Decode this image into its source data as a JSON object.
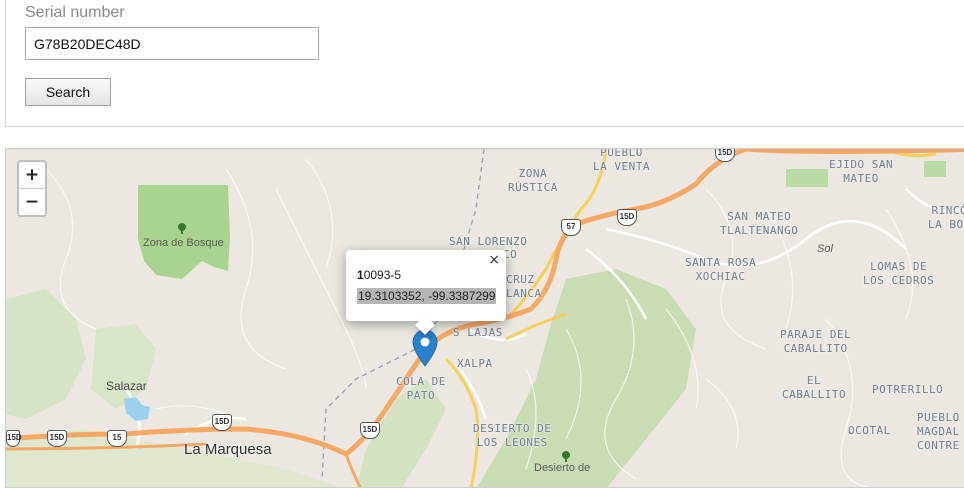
{
  "search": {
    "label": "Serial number",
    "serial_value": "G78B20DEC48D",
    "button_label": "Search"
  },
  "map": {
    "zoom_in": "+",
    "zoom_out": "−",
    "popup": {
      "title_first": "1",
      "title_rest": "0093-5",
      "coordinates": "19.3103352, -99.3387299",
      "close": "×"
    },
    "places": {
      "zona_bosque": "Zona de Bosque",
      "salazar": "Salazar",
      "la_marquesa": "La Marquesa",
      "pueblo_venta_1": "PUEBLO",
      "pueblo_venta_2": "LA VENTA",
      "zona_rustica_1": "ZONA",
      "zona_rustica_2": "RÚSTICA",
      "ejido_1": "EJIDO SAN",
      "ejido_2": "MATEO",
      "rincon_1": "RINCÓN",
      "rincon_2": "LA BOLS",
      "san_lorenzo": "SAN LORENZO",
      "san_lorenzo_b": "CO",
      "san_mateo_1": "SAN MATEO",
      "san_mateo_2": "TLALTENANGO",
      "sol": "Sol",
      "santa_rosa_1": "SANTA ROSA",
      "santa_rosa_2": "XOCHIAC",
      "lomas_1": "LOMAS DE",
      "lomas_2": "LOS CEDROS",
      "cruz_1": "CRUZ",
      "cruz_2": "LANCA",
      "las_lajas": "S LAJAS",
      "xalpa": "XALPA",
      "cola_1": "COLA DE",
      "cola_2": "PATO",
      "paraje_1": "PARAJE DEL",
      "paraje_2": "CABALLITO",
      "el_cab_1": "EL",
      "el_cab_2": "CABALLITO",
      "potrerillo": "POTRERILLO",
      "desierto_1": "DESIERTO DE",
      "desierto_2": "LOS LEONES",
      "desierto_park": "Desierto de",
      "ocotal": "OCOTAL",
      "pueblo_mag_1": "PUEBLO",
      "pueblo_mag_2": "MAGDAL",
      "pueblo_mag_3": "CONTRE"
    },
    "shields": {
      "s1": "15D",
      "s2": "57",
      "s3": "15D",
      "s4": "15D",
      "s5": "15",
      "s6": "15D",
      "s7": "15D",
      "s8": "15D"
    }
  }
}
